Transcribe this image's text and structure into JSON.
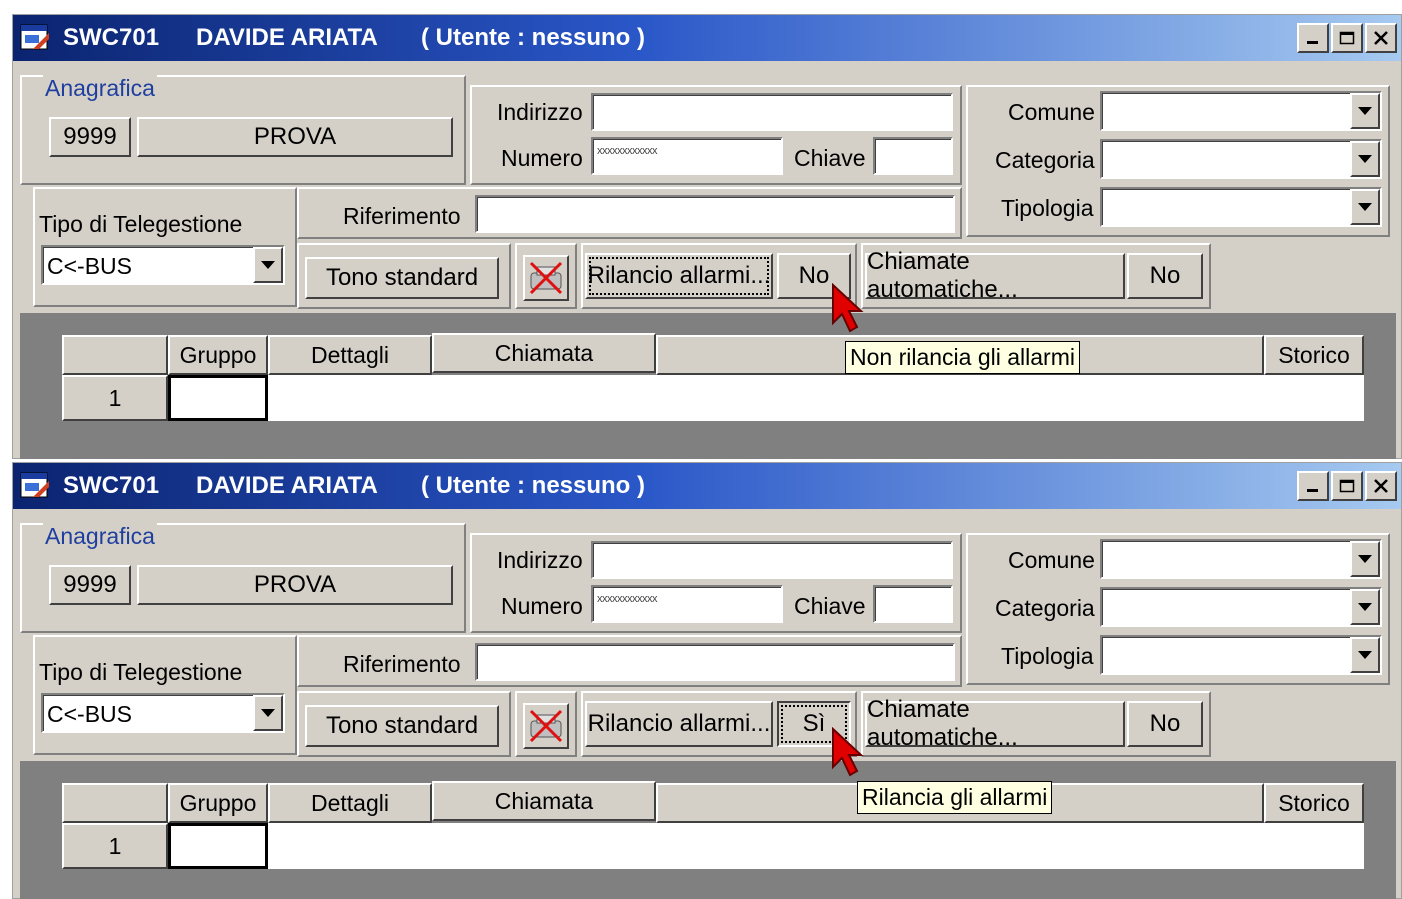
{
  "app": {
    "code": "SWC701",
    "owner": "DAVIDE ARIATA",
    "user_label": "( Utente : nessuno )"
  },
  "form": {
    "anagrafica_label": "Anagrafica",
    "code": "9999",
    "name": "PROVA",
    "indirizzo_label": "Indirizzo",
    "indirizzo_value": "",
    "numero_label": "Numero",
    "numero_value": "xxxxxxxxxxxx",
    "chiave_label": "Chiave",
    "chiave_value": "",
    "comune_label": "Comune",
    "categoria_label": "Categoria",
    "tipologia_label": "Tipologia",
    "riferimento_label": "Riferimento",
    "tipo_telegestione_label": "Tipo di Telegestione",
    "tipo_telegestione_value": "C<-BUS",
    "tono_label": "Tono standard",
    "rilancio_label": "Rilancio allarmi...",
    "chiamate_label": "Chiamate automatiche...",
    "chiamate_value": "No"
  },
  "grid": {
    "columns": [
      "Gruppo",
      "Dettagli",
      "Chiamata",
      "Storico"
    ],
    "row_number": "1"
  },
  "screens": [
    {
      "rilancio_value": "No",
      "tooltip": "Non rilancia gli allarmi"
    },
    {
      "rilancio_value": "Sì",
      "tooltip": "Rilancia gli allarmi"
    }
  ],
  "colors": {
    "title_start": "#0b2470",
    "title_end": "#a6caf0",
    "face": "#d4d0c8",
    "group_title": "#1f3f9f",
    "tooltip_bg": "#ffffe1",
    "cursor": "#e00000"
  },
  "icons": {
    "app": "app-window-icon",
    "minimize": "minimize-icon",
    "maximize": "maximize-icon",
    "close": "close-icon",
    "no_tone": "muted-phone-icon",
    "pointer": "arrow-cursor-icon"
  }
}
